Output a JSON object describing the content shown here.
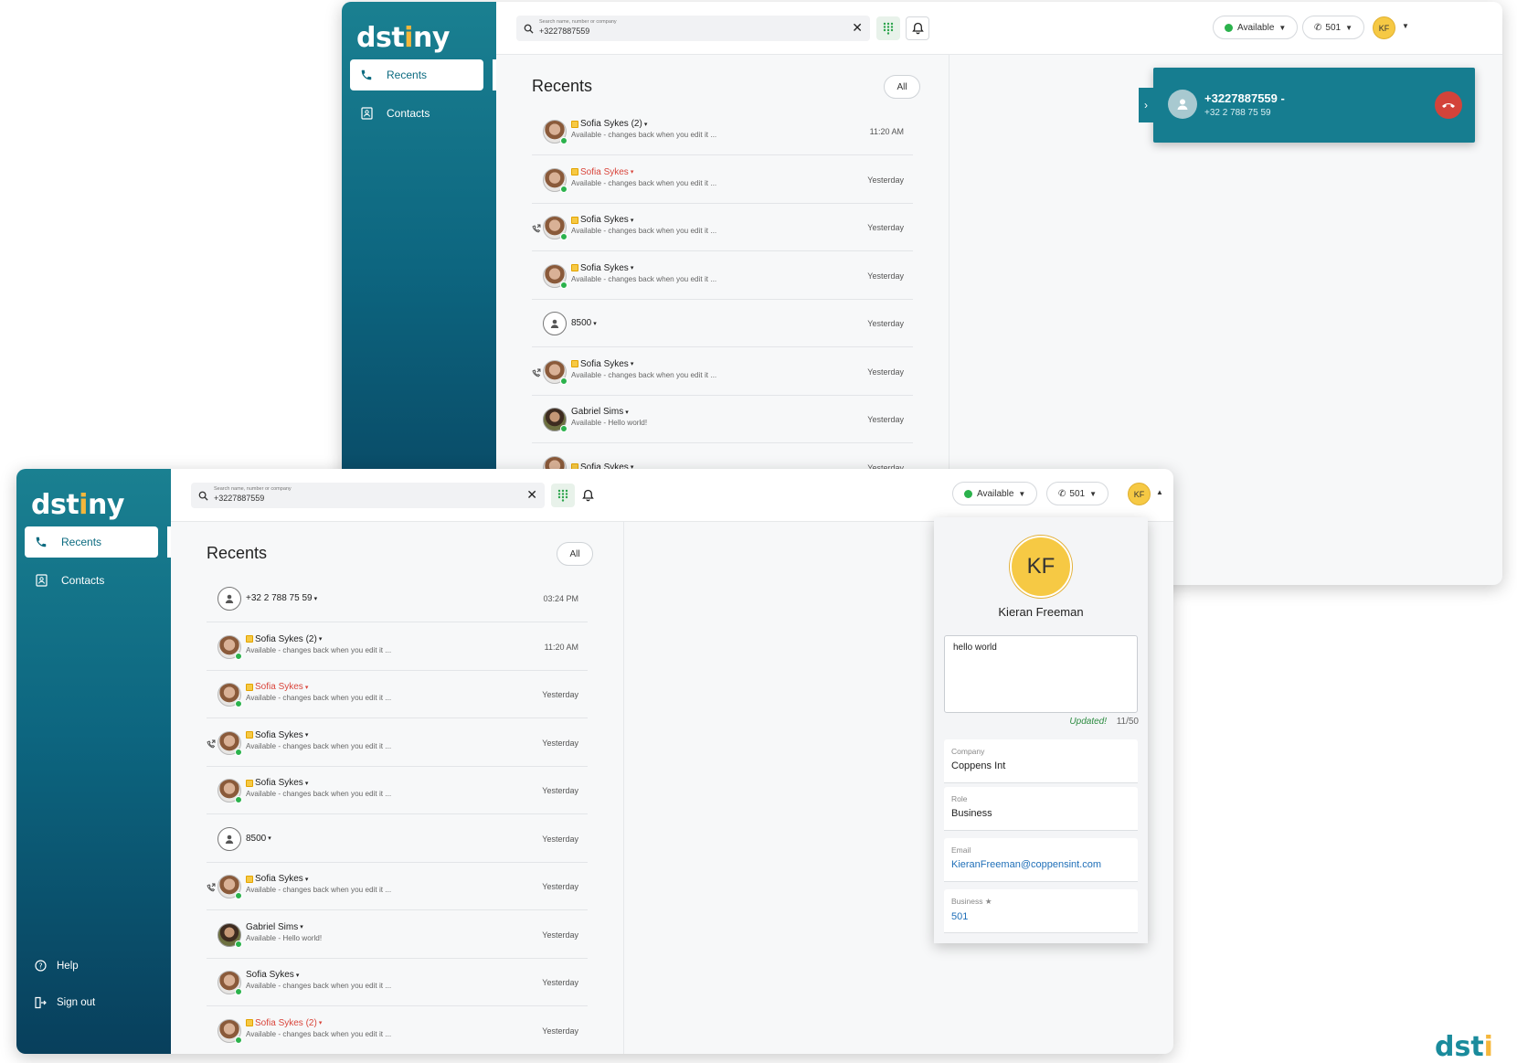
{
  "brand": {
    "logo_pre": "dst",
    "logo_dot": "i",
    "logo_post": "ny",
    "color_primary": "#167d90",
    "color_accent": "#f5b73b"
  },
  "back_window": {
    "nav": [
      {
        "label": "Recents",
        "icon": "phone-icon"
      },
      {
        "label": "Contacts",
        "icon": "contact-card-icon"
      }
    ],
    "search": {
      "placeholder": "Search name, number or company",
      "value": "+3227887559"
    },
    "status_label": "Available",
    "line_label": "501",
    "avatar_initials": "KF",
    "recents_title": "Recents",
    "filter_label": "All",
    "rows": [
      {
        "name": "Sofia Sykes (2)",
        "sub": "Available - changes back when you edit it ...",
        "time": "11:20 AM",
        "missed": false,
        "fav": true,
        "avatar": "photo",
        "callback": false
      },
      {
        "name": "Sofia Sykes",
        "sub": "Available - changes back when you edit it ...",
        "time": "Yesterday",
        "missed": true,
        "fav": true,
        "avatar": "photo",
        "callback": false
      },
      {
        "name": "Sofia Sykes",
        "sub": "Available - changes back when you edit it ...",
        "time": "Yesterday",
        "missed": false,
        "fav": true,
        "avatar": "photo",
        "callback": true
      },
      {
        "name": "Sofia Sykes",
        "sub": "Available - changes back when you edit it ...",
        "time": "Yesterday",
        "missed": false,
        "fav": true,
        "avatar": "photo",
        "callback": false
      },
      {
        "name": "8500",
        "sub": "",
        "time": "Yesterday",
        "missed": false,
        "fav": false,
        "avatar": "generic",
        "callback": false
      },
      {
        "name": "Sofia Sykes",
        "sub": "Available - changes back when you edit it ...",
        "time": "Yesterday",
        "missed": false,
        "fav": true,
        "avatar": "photo",
        "callback": true
      },
      {
        "name": "Gabriel Sims",
        "sub": "Available - Hello world!",
        "time": "Yesterday",
        "missed": false,
        "fav": false,
        "avatar": "photo2",
        "callback": false
      },
      {
        "name": "Sofia Sykes",
        "sub": "",
        "time": "Yesterday",
        "missed": false,
        "fav": true,
        "avatar": "photo",
        "callback": false
      }
    ],
    "active_call": {
      "number": "+3227887559 -",
      "formatted": "+32 2 788 75 59"
    }
  },
  "front_window": {
    "nav": [
      {
        "label": "Recents",
        "icon": "phone-icon"
      },
      {
        "label": "Contacts",
        "icon": "contact-card-icon"
      }
    ],
    "bottom_nav": [
      {
        "label": "Help",
        "icon": "help-icon"
      },
      {
        "label": "Sign out",
        "icon": "sign-out-icon"
      }
    ],
    "search": {
      "placeholder": "Search name, number or company",
      "value": "+3227887559"
    },
    "status_label": "Available",
    "line_label": "501",
    "avatar_initials": "KF",
    "recents_title": "Recents",
    "filter_label": "All",
    "rows": [
      {
        "name": "+32 2 788 75 59",
        "sub": "",
        "time": "03:24 PM",
        "missed": false,
        "fav": false,
        "avatar": "generic",
        "callback": false
      },
      {
        "name": "Sofia Sykes (2)",
        "sub": "Available - changes back when you edit it ...",
        "time": "11:20 AM",
        "missed": false,
        "fav": true,
        "avatar": "photo",
        "callback": false
      },
      {
        "name": "Sofia Sykes",
        "sub": "Available - changes back when you edit it ...",
        "time": "Yesterday",
        "missed": true,
        "fav": true,
        "avatar": "photo",
        "callback": false
      },
      {
        "name": "Sofia Sykes",
        "sub": "Available - changes back when you edit it ...",
        "time": "Yesterday",
        "missed": false,
        "fav": true,
        "avatar": "photo",
        "callback": true
      },
      {
        "name": "Sofia Sykes",
        "sub": "Available - changes back when you edit it ...",
        "time": "Yesterday",
        "missed": false,
        "fav": true,
        "avatar": "photo",
        "callback": false
      },
      {
        "name": "8500",
        "sub": "",
        "time": "Yesterday",
        "missed": false,
        "fav": false,
        "avatar": "generic",
        "callback": false
      },
      {
        "name": "Sofia Sykes",
        "sub": "Available - changes back when you edit it ...",
        "time": "Yesterday",
        "missed": false,
        "fav": true,
        "avatar": "photo",
        "callback": true
      },
      {
        "name": "Gabriel Sims",
        "sub": "Available - Hello world!",
        "time": "Yesterday",
        "missed": false,
        "fav": false,
        "avatar": "photo2",
        "callback": false
      },
      {
        "name": "Sofia Sykes",
        "sub": "Available - changes back when you edit it ...",
        "time": "Yesterday",
        "missed": false,
        "fav": false,
        "avatar": "photo",
        "callback": false
      },
      {
        "name": "Sofia Sykes (2)",
        "sub": "Available - changes back when you edit it ...",
        "time": "Yesterday",
        "missed": true,
        "fav": true,
        "avatar": "photo",
        "callback": false
      }
    ]
  },
  "profile": {
    "initials": "KF",
    "name": "Kieran Freeman",
    "status_note": "hello world",
    "updated_label": "Updated!",
    "counter": "11/50",
    "fields": [
      {
        "label": "Company",
        "value": "Coppens Int",
        "link": false
      },
      {
        "label": "Role",
        "value": "Business",
        "link": false
      },
      {
        "label": "Email",
        "value": "KieranFreeman@coppensint.com",
        "link": true
      },
      {
        "label": "Business ★",
        "value": "501",
        "link": true
      }
    ]
  }
}
